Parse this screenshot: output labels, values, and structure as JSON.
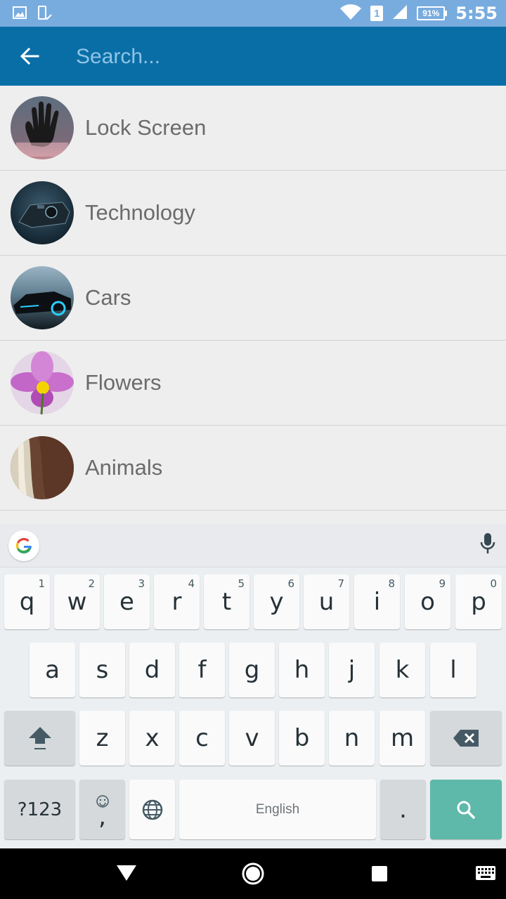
{
  "status_bar": {
    "time": "5:55",
    "battery_percent": "91%",
    "sim_number": "1",
    "icons": [
      "image-icon",
      "phone-check-icon",
      "wifi-icon",
      "sim-icon",
      "signal-icon",
      "battery-icon"
    ]
  },
  "app_bar": {
    "back_icon": "arrow-back-icon",
    "search_placeholder": "Search...",
    "search_value": ""
  },
  "categories": [
    {
      "label": "Lock Screen"
    },
    {
      "label": "Technology"
    },
    {
      "label": "Cars"
    },
    {
      "label": "Flowers"
    },
    {
      "label": "Animals"
    }
  ],
  "keyboard": {
    "row1": [
      {
        "key": "q",
        "hint": "1"
      },
      {
        "key": "w",
        "hint": "2"
      },
      {
        "key": "e",
        "hint": "3"
      },
      {
        "key": "r",
        "hint": "4"
      },
      {
        "key": "t",
        "hint": "5"
      },
      {
        "key": "y",
        "hint": "6"
      },
      {
        "key": "u",
        "hint": "7"
      },
      {
        "key": "i",
        "hint": "8"
      },
      {
        "key": "o",
        "hint": "9"
      },
      {
        "key": "p",
        "hint": "0"
      }
    ],
    "row2": [
      "a",
      "s",
      "d",
      "f",
      "g",
      "h",
      "j",
      "k",
      "l"
    ],
    "row3": [
      "z",
      "x",
      "c",
      "v",
      "b",
      "n",
      "m"
    ],
    "symbols_label": "?123",
    "comma_label": ",",
    "space_label": "English",
    "period_label": ".",
    "colors": {
      "action": "#5eb9aa",
      "background": "#eceff1"
    }
  },
  "nav_bar": {
    "icons": [
      "back-triangle-icon",
      "home-circle-icon",
      "recents-square-icon",
      "keyboard-switch-icon"
    ]
  },
  "colors": {
    "status_bar": "#78acdf",
    "app_bar": "#0a6ea6",
    "list_bg": "#eeeeee"
  }
}
